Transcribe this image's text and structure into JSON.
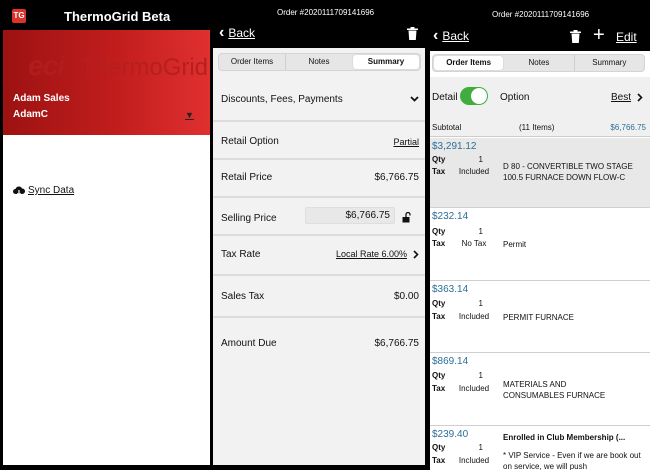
{
  "left": {
    "badge": "TG",
    "app_title": "ThermoGrid Beta",
    "logo_eci": "eci",
    "logo_thermogrid": "ThermoGrid",
    "user_name": "Adam Sales",
    "user_id": "AdamC",
    "sync_label": "Sync Data"
  },
  "middle": {
    "order_number": "Order #2020111709141696",
    "back_label": "Back",
    "tabs": [
      "Order Items",
      "Notes",
      "Summary"
    ],
    "active_tab": "Summary",
    "discounts_label": "Discounts, Fees, Payments",
    "retail_option_label": "Retail Option",
    "retail_option_value": "Partial",
    "retail_price_label": "Retail Price",
    "retail_price_value": "$6,766.75",
    "selling_price_label": "Selling Price",
    "selling_price_value": "$6,766.75",
    "tax_rate_label": "Tax Rate",
    "tax_rate_value": "Local Rate  6.00%",
    "sales_tax_label": "Sales Tax",
    "sales_tax_value": "$0.00",
    "amount_due_label": "Amount Due",
    "amount_due_value": "$6,766.75"
  },
  "right": {
    "order_number": "Order #2020111709141696",
    "back_label": "Back",
    "edit_label": "Edit",
    "tabs": [
      "Order Items",
      "Notes",
      "Summary"
    ],
    "active_tab": "Order Items",
    "detail_label": "Detail",
    "detail_toggle_on": true,
    "option_label": "Option",
    "best_label": "Best",
    "subtotal_label": "Subtotal",
    "items_count": "(11 Items)",
    "subtotal_value": "$6,766.75",
    "qty_label": "Qty",
    "tax_label": "Tax",
    "items": [
      {
        "price": "$3,291.12",
        "qty": "1",
        "tax": "Included",
        "desc": "D  80 - CONVERTIBLE TWO STAGE 100.5 FURNACE DOWN FLOW-C"
      },
      {
        "price": "$232.14",
        "qty": "1",
        "tax": "No Tax",
        "desc": "Permit"
      },
      {
        "price": "$363.14",
        "qty": "1",
        "tax": "Included",
        "desc": "PERMIT FURNACE"
      },
      {
        "price": "$869.14",
        "qty": "1",
        "tax": "Included",
        "desc": "MATERIALS AND CONSUMABLES FURNACE"
      },
      {
        "price": "$239.40",
        "qty": "1",
        "tax": "Included",
        "desc": "Enrolled in Club Membership  (...",
        "desc2": "* VIP Service - Even if we are book out on service, we will push"
      }
    ]
  },
  "colors": {
    "brand_red": "#d9332b",
    "price_blue": "#2a6f98",
    "toggle_green": "#3fae3f"
  }
}
